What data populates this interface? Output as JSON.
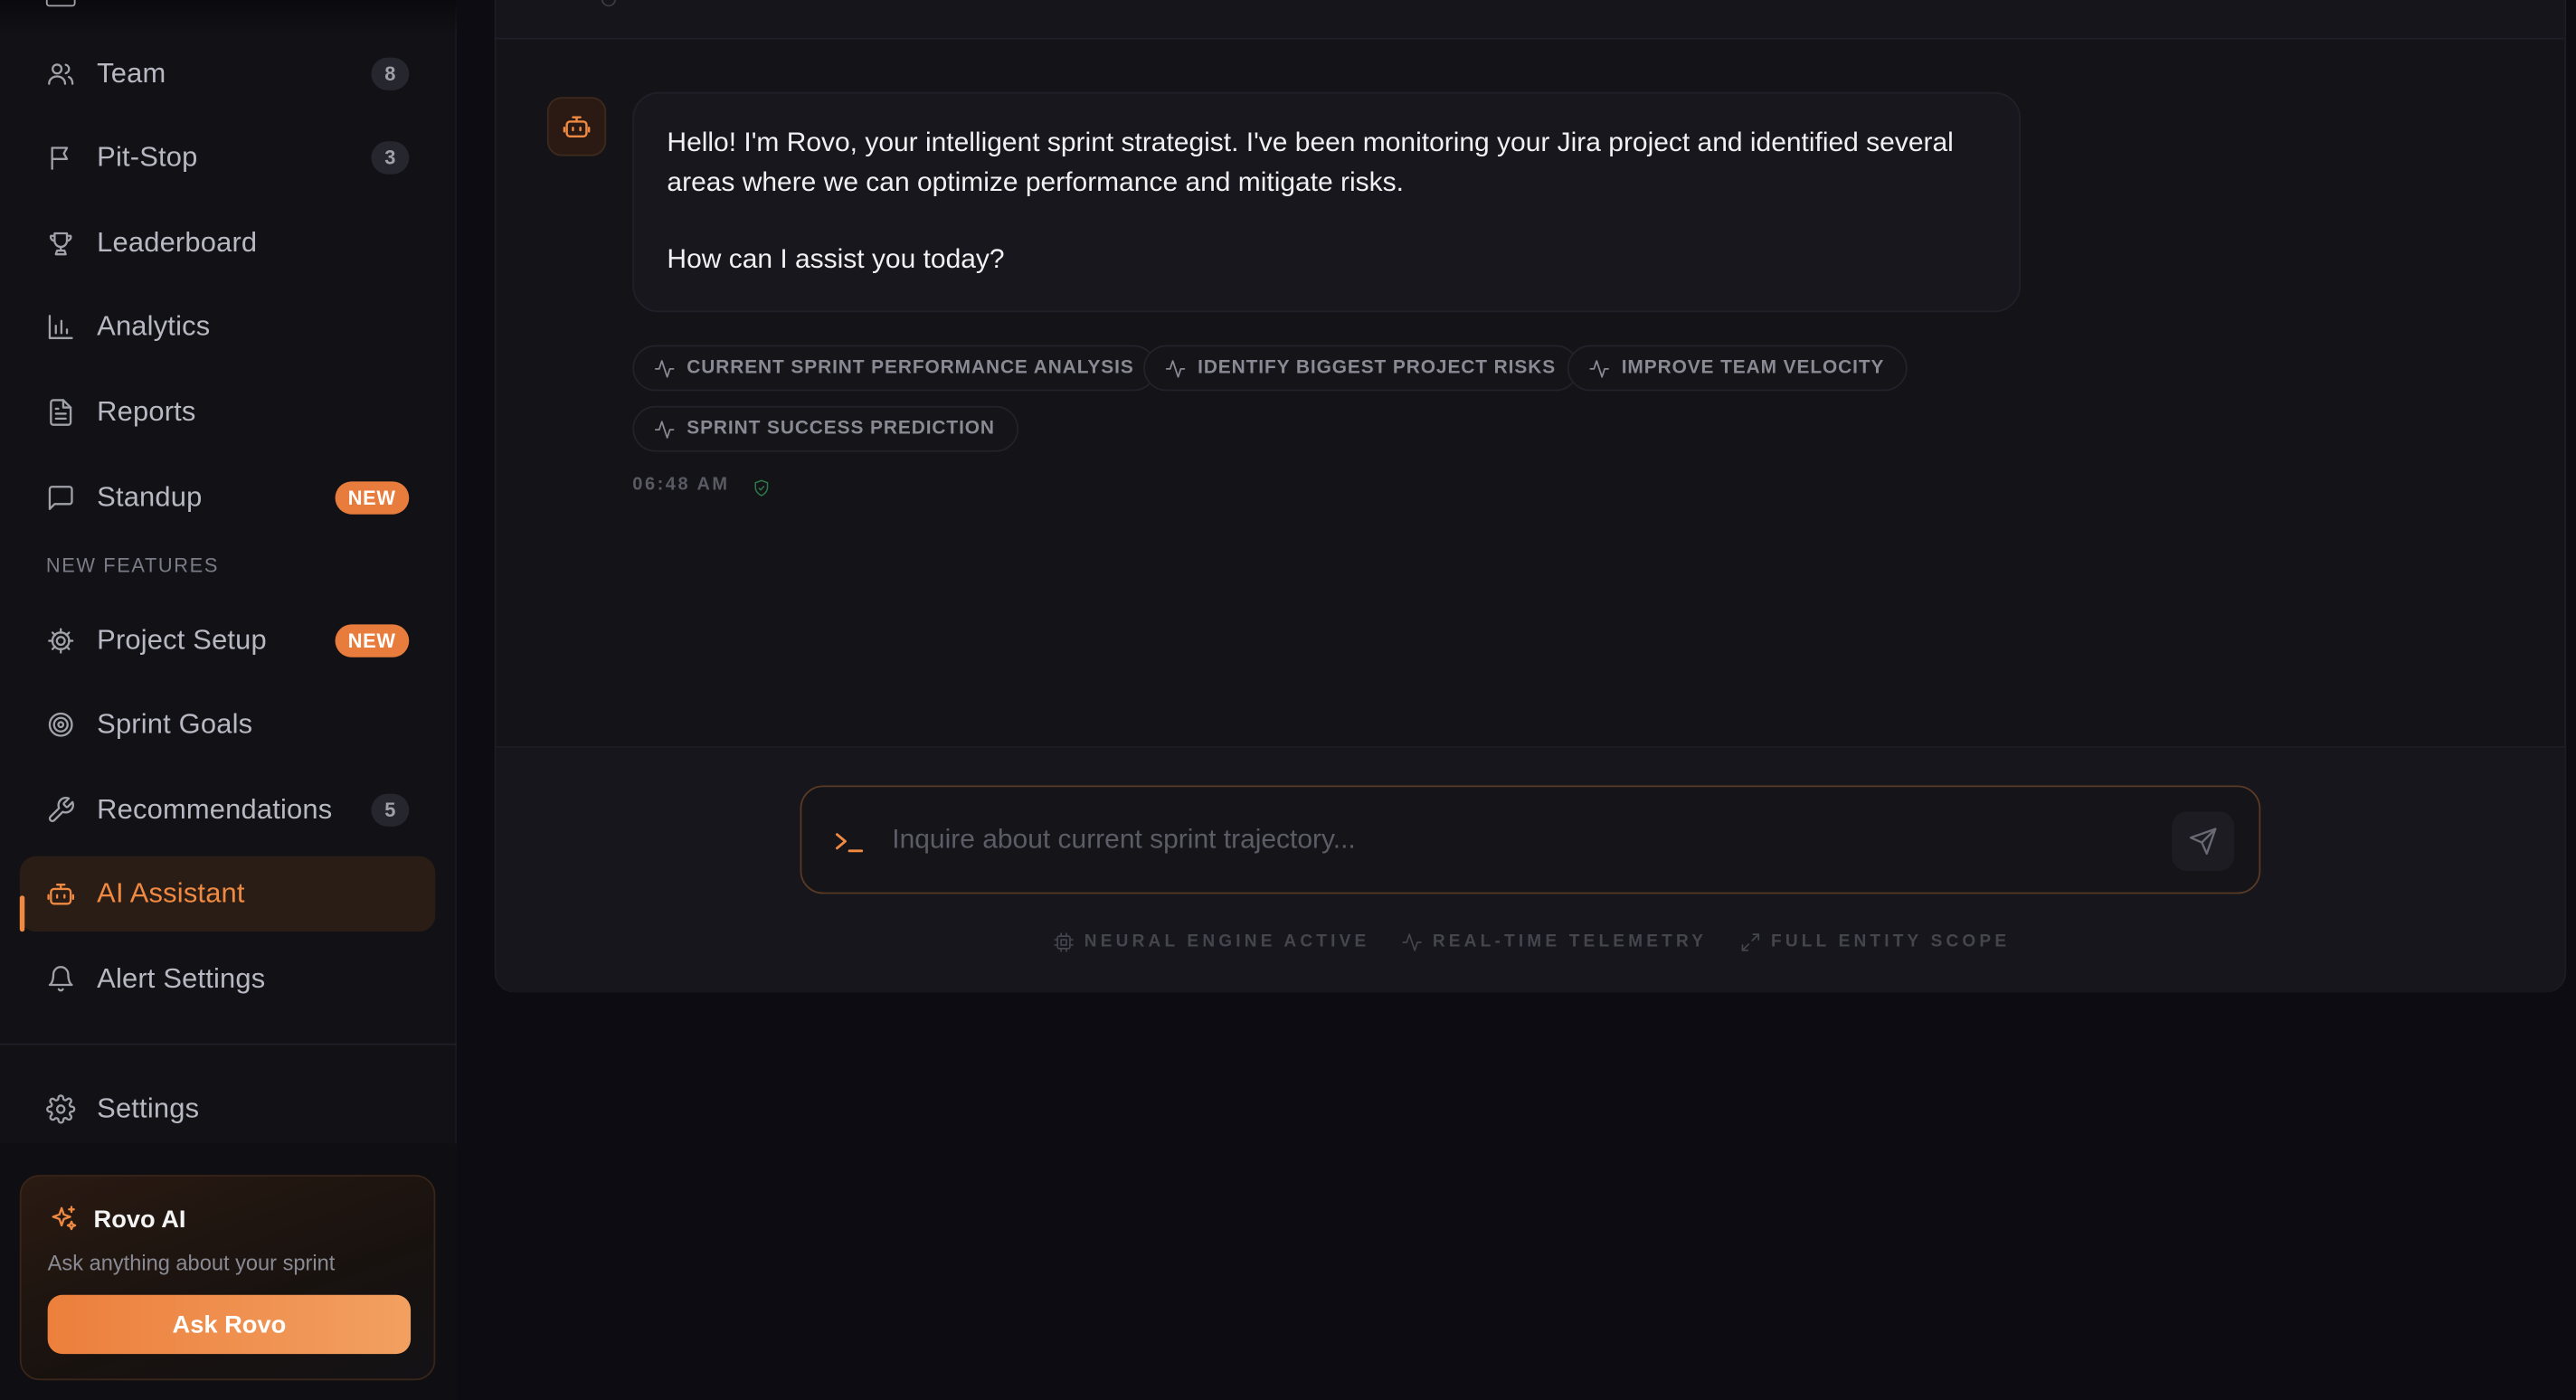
{
  "sidebar": {
    "items": [
      {
        "label": "Team",
        "icon": "users-icon",
        "count": "8"
      },
      {
        "label": "Pit-Stop",
        "icon": "flag-icon",
        "count": "3"
      },
      {
        "label": "Leaderboard",
        "icon": "trophy-icon"
      },
      {
        "label": "Analytics",
        "icon": "bar-chart-icon"
      },
      {
        "label": "Reports",
        "icon": "file-text-icon"
      },
      {
        "label": "Standup",
        "icon": "message-square-icon",
        "badge": "NEW"
      }
    ],
    "section_label": "NEW FEATURES",
    "feature_items": [
      {
        "label": "Project Setup",
        "icon": "gear-cog-icon",
        "badge": "NEW"
      },
      {
        "label": "Sprint Goals",
        "icon": "target-icon"
      },
      {
        "label": "Recommendations",
        "icon": "wrench-icon",
        "count": "5"
      },
      {
        "label": "AI Assistant",
        "icon": "bot-icon",
        "active": true
      },
      {
        "label": "Alert Settings",
        "icon": "bell-icon"
      }
    ],
    "settings_label": "Settings",
    "rovo_card": {
      "title": "Rovo AI",
      "subtitle": "Ask anything about your sprint",
      "button_label": "Ask Rovo"
    }
  },
  "chat": {
    "message_paragraphs": [
      "Hello! I'm Rovo, your intelligent sprint strategist. I've been monitoring your Jira project and identified several areas where we can optimize performance and mitigate risks.",
      "How can I assist you today?"
    ],
    "suggestions": [
      "CURRENT SPRINT PERFORMANCE ANALYSIS",
      "IDENTIFY BIGGEST PROJECT RISKS",
      "IMPROVE TEAM VELOCITY",
      "SPRINT SUCCESS PREDICTION"
    ],
    "timestamp": "06:48 AM"
  },
  "composer": {
    "placeholder": "Inquire about current sprint trajectory...",
    "value": ""
  },
  "status_bar": [
    {
      "label": "NEURAL ENGINE ACTIVE",
      "icon": "cpu-icon"
    },
    {
      "label": "REAL-TIME TELEMETRY",
      "icon": "activity-icon"
    },
    {
      "label": "FULL ENTITY SCOPE",
      "icon": "expand-icon"
    }
  ],
  "colors": {
    "accent": "#f08a42",
    "background": "#0c0c12",
    "sidebar": "#111116",
    "badge_new": "#e87c3c"
  }
}
